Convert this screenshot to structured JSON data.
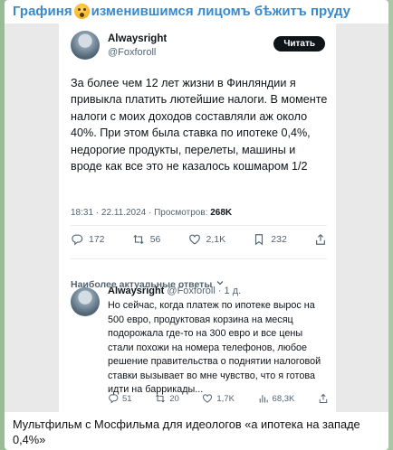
{
  "channel": {
    "name_part1": "Графиня",
    "name_part2": "изменившимся лицомъ бѣжитъ пруду",
    "emoji_icon": "astonished-face-emoji",
    "name_color": "#3a8acb"
  },
  "tweet": {
    "author_name": "Alwaysright",
    "author_handle": "@Foxforoll",
    "read_button_label": "Читать",
    "text": "За более чем 12 лет жизни в Финляндии я привыкла платить лютейшие налоги. В моменте налоги с моих доходов составляли аж около 40%. При этом была ставка по ипотеке 0,4%, недорогие продукты, перелеты, машины и вроде как все это не казалось кошмаром 1/2",
    "time": "18:31 · 22.11.2024 · Просмотров:",
    "views": "268K",
    "stats": {
      "replies": "172",
      "retweets": "56",
      "likes": "2,1K",
      "bookmarks": "232"
    }
  },
  "relevant_label": "Наиболее актуальные ответы",
  "reply": {
    "author_name": "Alwaysright",
    "meta": "@Foxforoll · 1 д.",
    "text": "Но сейчас, когда платеж по ипотеке вырос на 500 евро, продуктовая корзина на месяц подорожала где-то на 300 евро и все цены стали похожи на номера телефонов, любое решение правительства о поднятии налоговой ставки вызывает во мне чувство, что я готова идти на баррикады...",
    "stats": {
      "replies": "51",
      "retweets": "20",
      "likes": "1,7K",
      "views": "68,3K"
    }
  },
  "caption": "Мультфильм с Мосфильма для идеологов «а ипотека на западе 0,4%»"
}
